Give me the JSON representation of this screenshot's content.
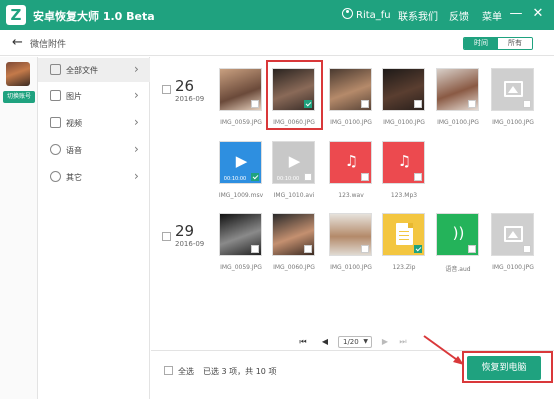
{
  "app": {
    "title": "安卓恢复大师 1.0 Beta",
    "logo_letter": "Z",
    "user_name": "Rita_fu",
    "menu": [
      "联系我们",
      "反馈",
      "菜单"
    ],
    "window_controls": [
      "minimize-icon",
      "close-icon"
    ],
    "accent_color": "#1fa27f"
  },
  "nav": {
    "back_icon": "back-arrow-icon",
    "title": "微信附件",
    "toggle": {
      "active": "时间",
      "inactive": "所有"
    }
  },
  "account": {
    "switch_label": "切换账号"
  },
  "categories": [
    {
      "label": "全部文件",
      "icon": "all-files-icon",
      "active": true
    },
    {
      "label": "图片",
      "icon": "image-icon",
      "active": false
    },
    {
      "label": "视频",
      "icon": "video-icon",
      "active": false
    },
    {
      "label": "语音",
      "icon": "voice-icon",
      "active": false
    },
    {
      "label": "其它",
      "icon": "other-icon",
      "active": false
    }
  ],
  "groups": [
    {
      "day": "26",
      "year_month": "2016-09",
      "files": [
        {
          "name": "IMG_0059.JPG",
          "type": "photo",
          "checked": false
        },
        {
          "name": "IMG_0060.JPG",
          "type": "photo",
          "checked": true
        },
        {
          "name": "IMG_0100.JPG",
          "type": "photo",
          "checked": false
        },
        {
          "name": "IMG_0100.JPG",
          "type": "photo",
          "checked": false
        },
        {
          "name": "IMG_0100.JPG",
          "type": "photo",
          "checked": false
        },
        {
          "name": "IMG_0100.JPG",
          "type": "image-placeholder",
          "checked": false
        },
        {
          "name": "IMG_1009.msv",
          "type": "video",
          "checked": true,
          "duration": "00:10:00"
        },
        {
          "name": "IMG_1010.avi",
          "type": "video-gray",
          "checked": false,
          "duration": "00:10:00"
        },
        {
          "name": "123.wav",
          "type": "audio",
          "checked": false
        },
        {
          "name": "123.Mp3",
          "type": "audio",
          "checked": false
        }
      ]
    },
    {
      "day": "29",
      "year_month": "2016-09",
      "files": [
        {
          "name": "IMG_0059.JPG",
          "type": "photo",
          "checked": false
        },
        {
          "name": "IMG_0060.JPG",
          "type": "photo",
          "checked": false
        },
        {
          "name": "IMG_0100.JPG",
          "type": "photo",
          "checked": false
        },
        {
          "name": "123.Zip",
          "type": "document",
          "checked": true
        },
        {
          "name": "语音.aud",
          "type": "voice",
          "checked": false
        },
        {
          "name": "IMG_0100.JPG",
          "type": "image-placeholder",
          "checked": false
        }
      ]
    }
  ],
  "pager": {
    "current": "1/20"
  },
  "footer": {
    "select_all": "全选",
    "selection_info": "已选 3 项，共 10 项",
    "recover_button": "恢复到电脑"
  }
}
